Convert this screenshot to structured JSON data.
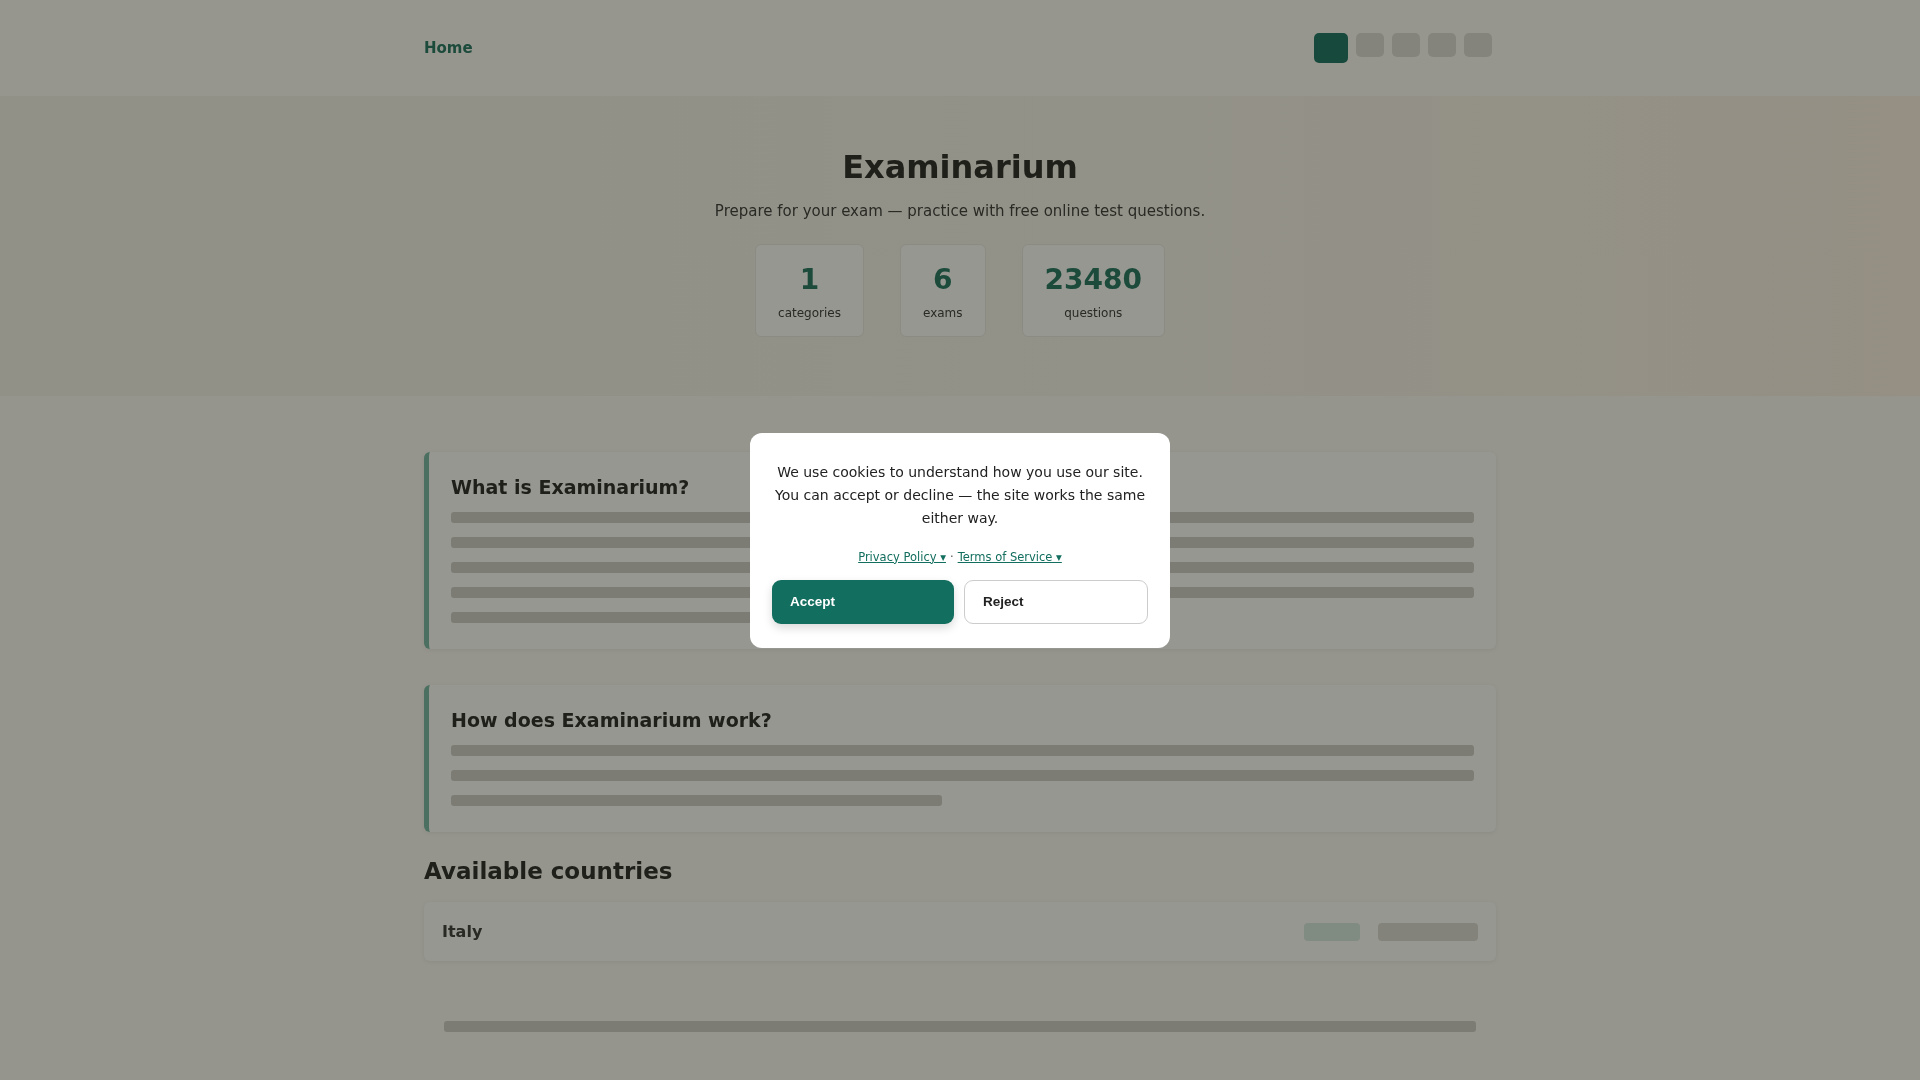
{
  "header": {
    "home_link": "Home",
    "languages": [
      {
        "selected": true
      },
      {
        "selected": false
      },
      {
        "selected": false
      },
      {
        "selected": false
      },
      {
        "selected": false
      }
    ]
  },
  "hero": {
    "title": "Examinarium",
    "subtitle": "Prepare for your exam — practice with free online test questions.",
    "stats": [
      {
        "value": "1",
        "label": "categories"
      },
      {
        "value": "6",
        "label": "exams"
      },
      {
        "value": "23480",
        "label": "questions"
      }
    ]
  },
  "sections": [
    {
      "title": "What is Examinarium?"
    },
    {
      "title": "How does Examinarium work?"
    }
  ],
  "countries": {
    "title": "Available countries",
    "items": [
      {
        "name": "Italy"
      }
    ]
  },
  "cookie_dialog": {
    "message": "We use cookies to understand how you use our site. You can accept or decline — the site works the same either way.",
    "links": [
      "Privacy Policy ▾",
      "Terms of Service ▾"
    ],
    "separator": "·",
    "buttons": [
      {
        "label": "Accept",
        "kind": "primary"
      },
      {
        "label": "Reject",
        "kind": "secondary"
      }
    ]
  }
}
